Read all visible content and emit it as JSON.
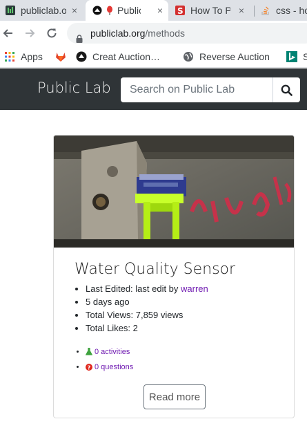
{
  "tabs": [
    {
      "title": "publiclab.org",
      "state": "inactive"
    },
    {
      "title": "Public Lab",
      "state": "active"
    },
    {
      "title": "How To Position",
      "state": "inactive"
    },
    {
      "title": "css - how to",
      "state": "inactive"
    }
  ],
  "tab_close_glyph": "×",
  "address": {
    "domain": "publiclab.org",
    "path": "/methods"
  },
  "bookmarks": [
    {
      "label": "Apps",
      "icon": "apps-grid-icon"
    },
    {
      "label": "",
      "icon": "gitlab-icon"
    },
    {
      "label": "Creat Auction…",
      "icon": "auction-icon"
    },
    {
      "label": "Reverse Auction",
      "icon": "globe-icon"
    },
    {
      "label": "S",
      "icon": "bing-icon"
    }
  ],
  "site": {
    "brand": "Public Lab",
    "search_placeholder": "Search on Public Lab"
  },
  "card": {
    "title": "Water Quality Sensor",
    "last_edited_prefix": "Last Edited: last edit by ",
    "last_edited_user": "warren",
    "age": "5 days ago",
    "views": "Total Views: 7,859 views",
    "likes": "Total Likes: 2",
    "activities": "0 activities",
    "questions": "0 questions",
    "read_more": "Read more"
  },
  "colors": {
    "header_bg": "#2f3437",
    "link": "#6f1ab1",
    "tabstrip": "#dee1e6",
    "question_red": "#e0281e",
    "activity_green": "#3fa33f"
  }
}
